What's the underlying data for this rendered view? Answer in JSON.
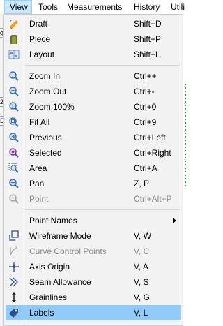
{
  "menubar": {
    "items": [
      {
        "label": "View"
      },
      {
        "label": "Tools"
      },
      {
        "label": "Measurements"
      },
      {
        "label": "History"
      },
      {
        "label": "Utili"
      }
    ]
  },
  "left_strip_labels": [
    "g",
    "2",
    "D"
  ],
  "menu": {
    "items": [
      {
        "label": "Draft",
        "shortcut": "Shift+D",
        "icon": "draft-icon"
      },
      {
        "label": "Piece",
        "shortcut": "Shift+P",
        "icon": "piece-icon"
      },
      {
        "label": "Layout",
        "shortcut": "Shift+L",
        "icon": "layout-icon"
      },
      {
        "label": "Zoom In",
        "shortcut": "Ctrl++",
        "icon": "zoom-in-icon"
      },
      {
        "label": "Zoom Out",
        "shortcut": "Ctrl+-",
        "icon": "zoom-out-icon"
      },
      {
        "label": "Zoom 100%",
        "shortcut": "Ctrl+0",
        "icon": "zoom-100-icon"
      },
      {
        "label": "Fit All",
        "shortcut": "Ctrl+9",
        "icon": "fit-all-icon"
      },
      {
        "label": "Previous",
        "shortcut": "Ctrl+Left",
        "icon": "zoom-previous-icon"
      },
      {
        "label": "Selected",
        "shortcut": "Ctrl+Right",
        "icon": "zoom-selected-icon"
      },
      {
        "label": "Area",
        "shortcut": "Ctrl+A",
        "icon": "zoom-area-icon"
      },
      {
        "label": "Pan",
        "shortcut": "Z, P",
        "icon": "pan-icon"
      },
      {
        "label": "Point",
        "shortcut": "Ctrl+Alt+P",
        "icon": "zoom-point-icon",
        "disabled": true
      },
      {
        "label": "Point Names",
        "shortcut": "",
        "icon": "",
        "submenu": true
      },
      {
        "label": "Wireframe Mode",
        "shortcut": "V, W",
        "icon": "wireframe-icon"
      },
      {
        "label": "Curve Control Points",
        "shortcut": "V, C",
        "icon": "curve-control-points-icon",
        "disabled": true
      },
      {
        "label": "Axis Origin",
        "shortcut": "V, A",
        "icon": "axis-origin-icon"
      },
      {
        "label": "Seam Allowance",
        "shortcut": "V, S",
        "icon": "seam-allowance-icon"
      },
      {
        "label": "Grainlines",
        "shortcut": "V, G",
        "icon": "grainlines-icon"
      },
      {
        "label": "Labels",
        "shortcut": "V, L",
        "icon": "labels-icon",
        "highlighted": true
      }
    ]
  },
  "colors": {
    "menu_bg": "#f2f2f2",
    "highlight": "#91c9f7",
    "active_menubar": "#cce8ff",
    "disabled_text": "#8c8c8c"
  }
}
